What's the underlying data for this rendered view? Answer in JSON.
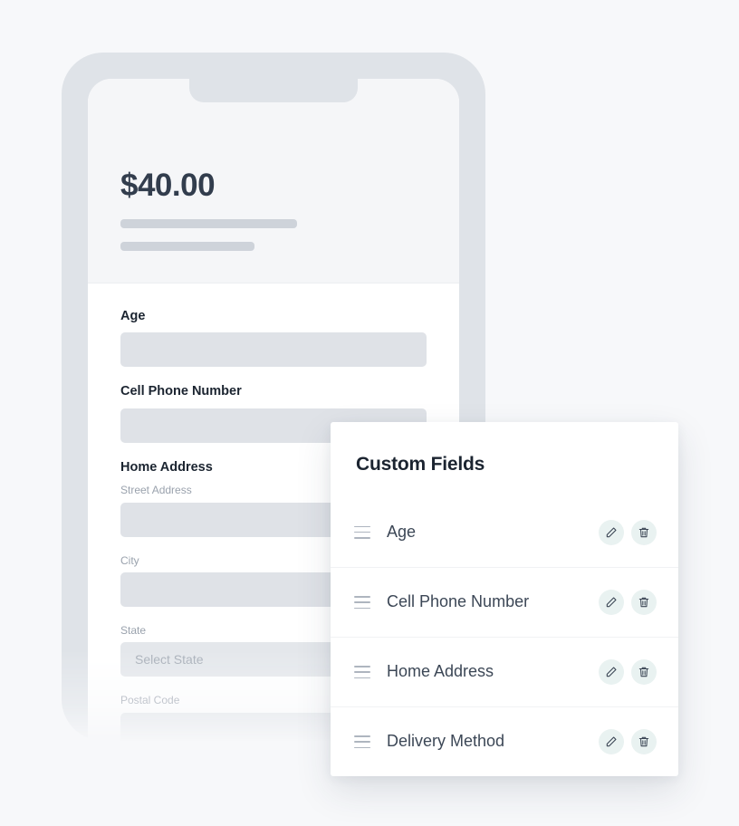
{
  "phone": {
    "header": {
      "price": "$40.00",
      "skeleton_lines": 2
    },
    "form": {
      "fields": [
        {
          "label": "Age",
          "type": "text",
          "value": "",
          "placeholder": ""
        },
        {
          "label": "Cell Phone Number",
          "type": "text",
          "value": "",
          "placeholder": ""
        }
      ],
      "address_group": {
        "label": "Home Address",
        "subfields": [
          {
            "label": "Street Address",
            "type": "text",
            "value": "",
            "placeholder": ""
          },
          {
            "label": "City",
            "type": "text",
            "value": "",
            "placeholder": ""
          },
          {
            "label": "State",
            "type": "select",
            "value": "",
            "placeholder": "Select State"
          },
          {
            "label": "Postal Code",
            "type": "text",
            "value": "",
            "placeholder": ""
          }
        ]
      }
    }
  },
  "panel": {
    "title": "Custom Fields",
    "rows": [
      {
        "label": "Age",
        "drag_icon": "drag-handle-icon",
        "edit_icon": "pencil-icon",
        "delete_icon": "trash-icon"
      },
      {
        "label": "Cell Phone Number",
        "drag_icon": "drag-handle-icon",
        "edit_icon": "pencil-icon",
        "delete_icon": "trash-icon"
      },
      {
        "label": "Home Address",
        "drag_icon": "drag-handle-icon",
        "edit_icon": "pencil-icon",
        "delete_icon": "trash-icon"
      },
      {
        "label": "Delivery Method",
        "drag_icon": "drag-handle-icon",
        "edit_icon": "pencil-icon",
        "delete_icon": "trash-icon"
      }
    ]
  },
  "colors": {
    "page_background": "#f7f8fa",
    "phone_bezel": "#dfe3e8",
    "screen_header": "#f5f6f8",
    "price_text": "#323d4d",
    "skeleton": "#ced3da",
    "input_fill": "#dfe2e7",
    "label_text": "#1b2430",
    "sublabel_text": "#9aa2ad",
    "placeholder_text": "#a8afb9",
    "panel_background": "#ffffff",
    "panel_title": "#1b2430",
    "row_label": "#3c4756",
    "row_divider": "#f1f2f4",
    "icon_button_background": "#e9f2f1",
    "icon_stroke": "#3c4756",
    "drag_handle": "#aeb5bf"
  }
}
